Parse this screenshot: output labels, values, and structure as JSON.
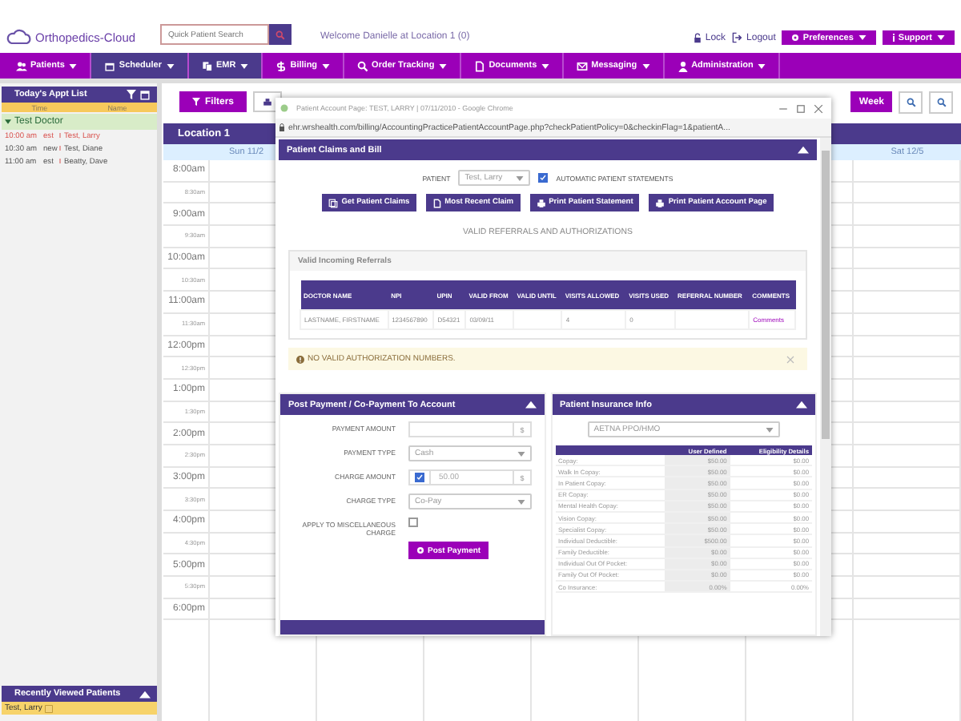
{
  "header": {
    "logo": "Orthopedics-Cloud",
    "search": {
      "placeholder": "Quick Patient Search"
    },
    "welcome": "Welcome Danielle at Location 1 (0)",
    "links": [
      {
        "label": "Lock",
        "kind": "lock"
      },
      {
        "label": "Logout",
        "kind": "logout"
      }
    ],
    "menus": [
      {
        "label": "Preferences",
        "kind": "gear"
      },
      {
        "label": "Support",
        "kind": "info"
      }
    ]
  },
  "nav": [
    {
      "label": "Patients",
      "selected": false
    },
    {
      "label": "Scheduler",
      "selected": true
    },
    {
      "label": "EMR",
      "selected": true
    },
    {
      "label": "Billing",
      "selected": false
    },
    {
      "label": "Order Tracking",
      "selected": false
    },
    {
      "label": "Documents",
      "selected": false
    },
    {
      "label": "Messaging",
      "selected": false
    },
    {
      "label": "Administration",
      "selected": false
    }
  ],
  "appt_list": {
    "title": "Today's Appt List",
    "columns": [
      "Time",
      "Name"
    ],
    "group": {
      "label": "Test Doctor",
      "expanded": true
    },
    "rows": [
      {
        "time": "10:00 am",
        "type": "est",
        "name": "Test, Larry",
        "current": true
      },
      {
        "time": "10:30 am",
        "type": "new",
        "name": "Test, Diane",
        "current": false
      },
      {
        "time": "11:00 am",
        "type": "est",
        "name": "Beatty, Dave",
        "current": false
      }
    ]
  },
  "recent": {
    "title": "Recently Viewed Patients",
    "items": [
      "Test, Larry"
    ]
  },
  "calendar": {
    "filters": "Filters",
    "view_button": "Week",
    "location": "Location 1",
    "days": [
      "Sun 11/2",
      "Sat 12/5"
    ],
    "times": [
      "8:00am",
      "8:30am",
      "9:00am",
      "9:30am",
      "10:00am",
      "10:30am",
      "11:00am",
      "11:30am",
      "12:00pm",
      "12:30pm",
      "1:00pm",
      "1:30pm",
      "2:00pm",
      "2:30pm",
      "3:00pm",
      "3:30pm",
      "4:00pm",
      "4:30pm",
      "5:00pm",
      "5:30pm",
      "6:00pm"
    ]
  },
  "popup": {
    "window_title": "Patient Account Page: TEST, LARRY | 07/11/2010 - Google Chrome",
    "url": "ehr.wrshealth.com/billing/AccountingPracticePatientAccountPage.php?checkPatientPolicy=0&checkinFlag=1&patientA...",
    "claims": {
      "title": "Patient Claims and Bill",
      "patient_label": "PATIENT",
      "patient_value": "Test, Larry",
      "auto_statements": {
        "label": "AUTOMATIC PATIENT STATEMENTS",
        "checked": true
      },
      "buttons": [
        {
          "label": "Get Patient Claims",
          "kind": "claims"
        },
        {
          "label": "Most Recent Claim",
          "kind": "document"
        },
        {
          "label": "Print Patient Statement",
          "kind": "print"
        },
        {
          "label": "Print Patient Account Page",
          "kind": "print"
        }
      ],
      "section_title": "VALID REFERRALS AND AUTHORIZATIONS",
      "referrals": {
        "title": "Valid Incoming Referrals",
        "columns": [
          "DOCTOR NAME",
          "NPI",
          "UPIN",
          "VALID FROM",
          "VALID UNTIL",
          "VISITS ALLOWED",
          "VISITS USED",
          "REFERRAL NUMBER",
          "COMMENTS"
        ],
        "rows": [
          {
            "cells": [
              "LASTNAME, FIRSTNAME",
              "1234567890",
              "D54321",
              "03/09/11",
              "",
              "4",
              "0",
              ""
            ],
            "link": "Comments"
          }
        ]
      },
      "alert": "NO VALID AUTHORIZATION NUMBERS."
    },
    "payment": {
      "title": "Post Payment / Co-Payment To Account",
      "fields": [
        {
          "label": "PAYMENT AMOUNT",
          "kind": "money",
          "addon": "$"
        },
        {
          "label": "PAYMENT TYPE",
          "kind": "select",
          "value": "Cash"
        },
        {
          "label": "CHARGE AMOUNT",
          "kind": "money_check",
          "checked": true,
          "value": "50.00",
          "addon": "$"
        },
        {
          "label": "CHARGE TYPE",
          "kind": "select",
          "value": "Co-Pay"
        },
        {
          "label": "APPLY TO MISCELLANEOUS CHARGE",
          "kind": "checkbox",
          "checked": false
        }
      ],
      "button": "Post Payment"
    },
    "insurance": {
      "title": "Patient Insurance Info",
      "plan": "AETNA PPO/HMO",
      "columns": [
        "",
        "User Defined",
        "Eligibility Details"
      ],
      "rows": [
        [
          "Copay:",
          "$50.00",
          "$0.00"
        ],
        [
          "Walk In Copay:",
          "$50.00",
          "$0.00"
        ],
        [
          "In Patient Copay:",
          "$50.00",
          "$0.00"
        ],
        [
          "ER Copay:",
          "$50.00",
          "$0.00"
        ],
        [
          "Mental Health Copay:",
          "$50.00",
          "$0.00"
        ],
        [
          "Vision Copay:",
          "$50.00",
          "$0.00"
        ],
        [
          "Specialist Copay:",
          "$50.00",
          "$0.00"
        ],
        [
          "Individual Deductible:",
          "$500.00",
          "$0.00"
        ],
        [
          "Family Deductible:",
          "$0.00",
          "$0.00"
        ],
        [
          "Individual Out Of Pocket:",
          "$0.00",
          "$0.00"
        ],
        [
          "Family Out Of Pocket:",
          "$0.00",
          "$0.00"
        ],
        [
          "Co Insurance:",
          "0.00%",
          "0.00%"
        ]
      ]
    }
  }
}
